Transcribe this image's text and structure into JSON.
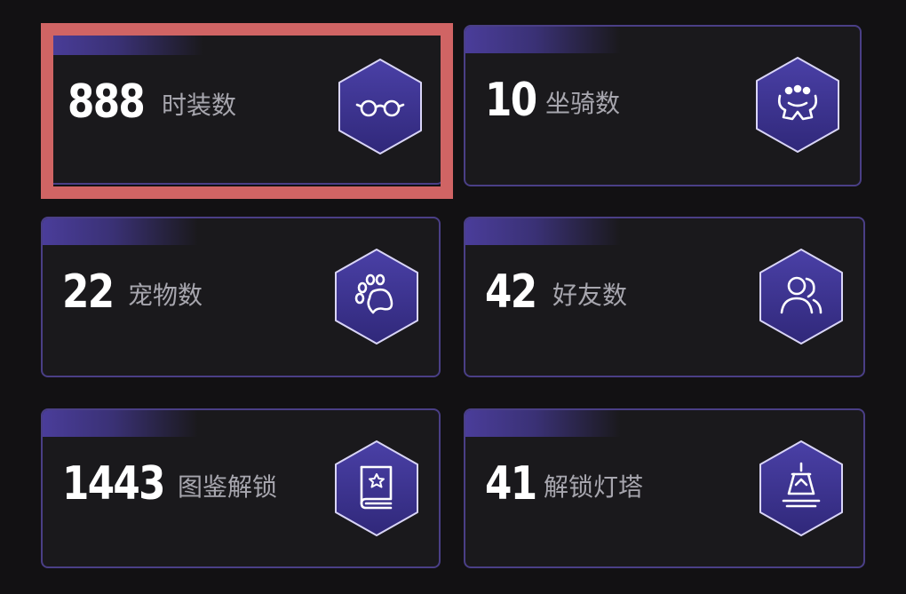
{
  "cards": [
    {
      "value": "888",
      "label": "时装数",
      "icon": "glasses-icon"
    },
    {
      "value": "10",
      "label": "坐骑数",
      "icon": "mount-icon"
    },
    {
      "value": "22",
      "label": "宠物数",
      "icon": "paw-icon"
    },
    {
      "value": "42",
      "label": "好友数",
      "icon": "friends-icon"
    },
    {
      "value": "1443",
      "label": "图鉴解锁",
      "icon": "book-star-icon"
    },
    {
      "value": "41",
      "label": "解锁灯塔",
      "icon": "lighthouse-icon"
    }
  ],
  "colors": {
    "background": "#121113",
    "card_border": "#4a3f86",
    "hex_fill": "#3f3596",
    "highlight": "#d06464"
  },
  "highlighted_card": "cards.0"
}
